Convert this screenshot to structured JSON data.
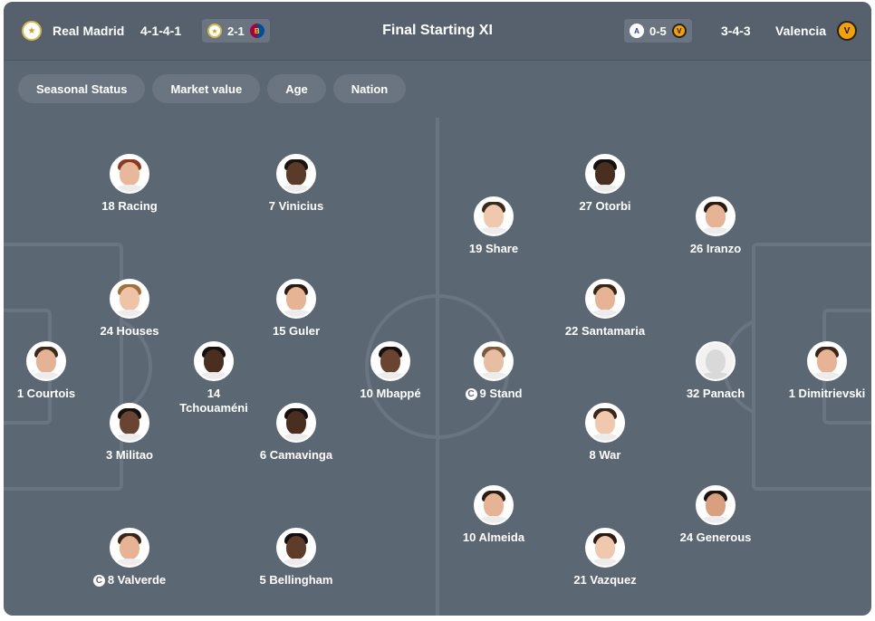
{
  "title": "Final Starting XI",
  "home": {
    "name": "Real Madrid",
    "formation": "4-1-4-1",
    "crest_icon": "real-madrid-crest",
    "last_result": {
      "score": "2-1",
      "home_icon": "real-madrid-crest",
      "away_icon": "barcelona-crest"
    }
  },
  "away": {
    "name": "Valencia",
    "formation": "3-4-3",
    "crest_icon": "valencia-crest",
    "last_result": {
      "score": "0-5",
      "home_icon": "albacete-crest",
      "away_icon": "valencia-crest"
    }
  },
  "filters": [
    "Seasonal Status",
    "Market value",
    "Age",
    "Nation"
  ],
  "home_players": [
    {
      "label": "18 Racing",
      "skin": "#e8b89a",
      "hair": "#8a3a20"
    },
    {
      "label": "7 Vinicius",
      "skin": "#5a3a28",
      "hair": "#1a1410"
    },
    {
      "label": "24 Houses",
      "skin": "#efc3a6",
      "hair": "#a0703a"
    },
    {
      "label": "15 Guler",
      "skin": "#e6b494",
      "hair": "#2a1c12"
    },
    {
      "label": "1 Courtois",
      "skin": "#e4b396",
      "hair": "#3a2a1a"
    },
    {
      "label": "14\nTchouaméni",
      "skin": "#4a2e20",
      "hair": "#151010"
    },
    {
      "label": "10 Mbappé",
      "skin": "#6a4430",
      "hair": "#151010"
    },
    {
      "label": "3 Militao",
      "skin": "#6a4432",
      "hair": "#151010"
    },
    {
      "label": "6 Camavinga",
      "skin": "#4a2e20",
      "hair": "#151010"
    },
    {
      "label": "8 Valverde",
      "skin": "#e6b494",
      "hair": "#3a2618",
      "captain": "C"
    },
    {
      "label": "5 Bellingham",
      "skin": "#5e3c2a",
      "hair": "#151010"
    }
  ],
  "away_players": [
    {
      "label": "27 Otorbi",
      "skin": "#4a2e20",
      "hair": "#151010"
    },
    {
      "label": "19 Share",
      "skin": "#efc8ae",
      "hair": "#3a2a1a"
    },
    {
      "label": "26 Iranzo",
      "skin": "#e6b494",
      "hair": "#2a1c12"
    },
    {
      "label": "22 Santamaria",
      "skin": "#e6b494",
      "hair": "#3a2618"
    },
    {
      "label": "9 Stand",
      "skin": "#e8bea2",
      "hair": "#7a5a3a",
      "captain": "C"
    },
    {
      "label": "32 Panach",
      "ghost": true
    },
    {
      "label": "1 Dimitrievski",
      "skin": "#e6b494",
      "hair": "#3a2618"
    },
    {
      "label": "8 War",
      "skin": "#efc8ae",
      "hair": "#3a2618"
    },
    {
      "label": "10 Almeida",
      "skin": "#e6b494",
      "hair": "#2a1c12"
    },
    {
      "label": "24 Generous",
      "skin": "#d8a07e",
      "hair": "#1a1410"
    },
    {
      "label": "21 Vazquez",
      "skin": "#efc8ae",
      "hair": "#2a1c12"
    }
  ]
}
